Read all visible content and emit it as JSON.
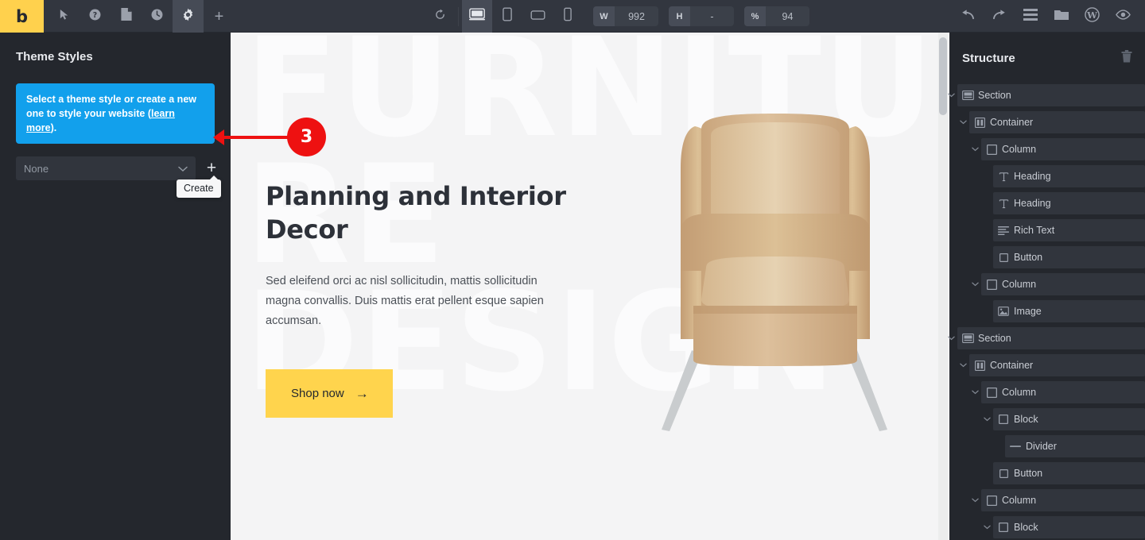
{
  "toolbar": {
    "logo_text": "b",
    "left_tools": [
      {
        "name": "pointer-tool",
        "icon": "cursor-icon",
        "active": false
      },
      {
        "name": "help-tool",
        "icon": "question-circle-icon",
        "active": false
      },
      {
        "name": "pages-tool",
        "icon": "page-icon",
        "active": false
      },
      {
        "name": "history-tool",
        "icon": "clock-icon",
        "active": false
      },
      {
        "name": "settings-tool",
        "icon": "gear-icon",
        "active": true
      },
      {
        "name": "add-tool",
        "icon": "plus-icon",
        "active": false
      }
    ],
    "refresh_label": "refresh-icon",
    "devices": [
      {
        "name": "desktop",
        "icon": "desktop-icon",
        "active": true
      },
      {
        "name": "tablet-portrait",
        "icon": "tablet-portrait-icon",
        "active": false
      },
      {
        "name": "tablet-landscape",
        "icon": "tablet-landscape-icon",
        "active": false
      },
      {
        "name": "mobile",
        "icon": "mobile-icon",
        "active": false
      }
    ],
    "width_key": "W",
    "width_value": "992",
    "height_key": "H",
    "height_value": "-",
    "zoom_key": "%",
    "zoom_value": "94",
    "right_tools": [
      {
        "name": "undo",
        "icon": "undo-arrow-icon"
      },
      {
        "name": "redo",
        "icon": "redo-arrow-icon"
      },
      {
        "name": "menu",
        "icon": "hamburger-icon"
      },
      {
        "name": "folder",
        "icon": "folder-icon"
      },
      {
        "name": "wordpress",
        "icon": "wordpress-icon"
      },
      {
        "name": "preview",
        "icon": "eye-icon"
      }
    ]
  },
  "left_panel": {
    "title": "Theme Styles",
    "notice_text_before": "Select a theme style or create a new one to style your website (",
    "notice_link": "learn more",
    "notice_text_after": ").",
    "select_value": "None",
    "select_placeholder": "None",
    "create_tooltip": "Create"
  },
  "canvas": {
    "watermark": "FURNITU\nRE\nDESIGN",
    "heading": "Planning and Interior Decor",
    "paragraph": "Sed eleifend orci ac nisl sollicitudin, mattis sollicitudin magna convallis. Duis mattis erat pellent esque sapien accumsan.",
    "button_label": "Shop now",
    "button_arrow": "→",
    "accent_yellow": "#ffd44d",
    "background": "#f4f4f5"
  },
  "right_panel": {
    "title": "Structure",
    "delete_icon": "trash-icon",
    "tree": [
      {
        "label": "Section",
        "depth": 0,
        "icon": "section-icon",
        "chevron": true
      },
      {
        "label": "Container",
        "depth": 1,
        "icon": "container-icon",
        "chevron": true
      },
      {
        "label": "Column",
        "depth": 2,
        "icon": "column-icon",
        "chevron": true
      },
      {
        "label": "Heading",
        "depth": 3,
        "icon": "text-icon",
        "chevron": false
      },
      {
        "label": "Heading",
        "depth": 3,
        "icon": "text-icon",
        "chevron": false
      },
      {
        "label": "Rich Text",
        "depth": 3,
        "icon": "richtext-icon",
        "chevron": false
      },
      {
        "label": "Button",
        "depth": 3,
        "icon": "button-icon",
        "chevron": false
      },
      {
        "label": "Column",
        "depth": 2,
        "icon": "column-icon",
        "chevron": true
      },
      {
        "label": "Image",
        "depth": 3,
        "icon": "image-icon",
        "chevron": false
      },
      {
        "label": "Section",
        "depth": 0,
        "icon": "section-icon",
        "chevron": true
      },
      {
        "label": "Container",
        "depth": 1,
        "icon": "container-icon",
        "chevron": true
      },
      {
        "label": "Column",
        "depth": 2,
        "icon": "column-icon",
        "chevron": true
      },
      {
        "label": "Block",
        "depth": 3,
        "icon": "block-icon",
        "chevron": true
      },
      {
        "label": "Divider",
        "depth": 4,
        "icon": "divider-icon",
        "chevron": false
      },
      {
        "label": "Button",
        "depth": 3,
        "icon": "button-icon",
        "chevron": false
      },
      {
        "label": "Column",
        "depth": 2,
        "icon": "column-icon",
        "chevron": true
      },
      {
        "label": "Block",
        "depth": 3,
        "icon": "block-icon",
        "chevron": true
      }
    ]
  },
  "annotation": {
    "badge_number": "3",
    "color": "#ee1111"
  }
}
